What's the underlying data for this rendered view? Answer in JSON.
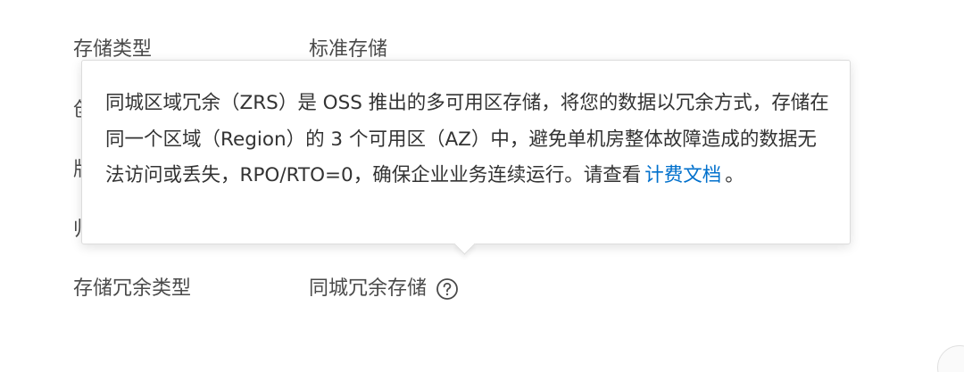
{
  "storage_type": {
    "label": "存储类型",
    "value": "标准存储"
  },
  "partial_rows": [
    {
      "text": "创"
    },
    {
      "text": "版"
    },
    {
      "text": "归"
    }
  ],
  "storage_redundancy": {
    "label": "存储冗余类型",
    "value": "同城冗余存储",
    "help_icon": "question-circle-icon"
  },
  "tooltip": {
    "text": "同城区域冗余（ZRS）是 OSS 推出的多可用区存储，将您的数据以冗余方式，存储在同一个区域（Region）的 3 个可用区（AZ）中，避免单机房整体故障造成的数据无法访问或丢失，RPO/RTO=0，确保企业业务连续运行。请查看",
    "link_text": "计费文档",
    "suffix": "。"
  },
  "colors": {
    "link": "#0070cc",
    "text": "#333333",
    "label": "#4a4a4a"
  }
}
